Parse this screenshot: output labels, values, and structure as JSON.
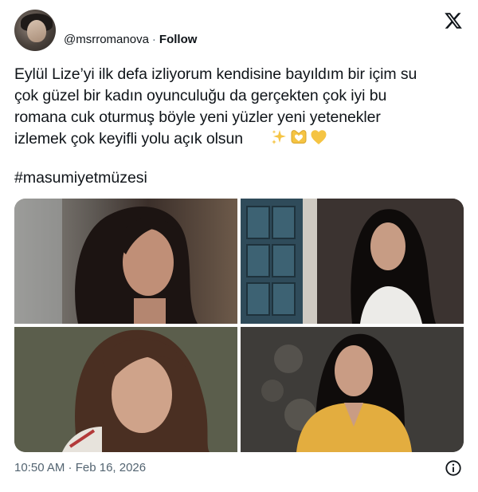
{
  "author": {
    "handle": "@msrromanova",
    "separator": "·",
    "follow_label": "Follow"
  },
  "platform_icon": "x-logo-icon",
  "tweet": {
    "text": "Eylül Lize’yi ilk defa izliyorum kendisine bayıldım bir içim su\nçok güzel bir kadın oyunculuğu da gerçekten çok iyi bu\nromana cuk oturmuş böyle yeni yüzler yeni yetenekler\nizlemek çok keyifli yolu açık olsun",
    "emojis": [
      "sparkles-icon",
      "heart-hands-icon",
      "yellow-heart-icon"
    ],
    "hashtag": "#masumiyetmüzesi"
  },
  "media": {
    "photos": [
      "photo-1",
      "photo-2",
      "photo-3",
      "photo-4"
    ]
  },
  "footer": {
    "timestamp": "10:50 AM · Feb 16, 2026",
    "info_icon": "info-icon"
  },
  "colors": {
    "text_primary": "#0f1419",
    "text_secondary": "#536471",
    "background": "#ffffff",
    "emoji_yellow": "#f5c443"
  }
}
